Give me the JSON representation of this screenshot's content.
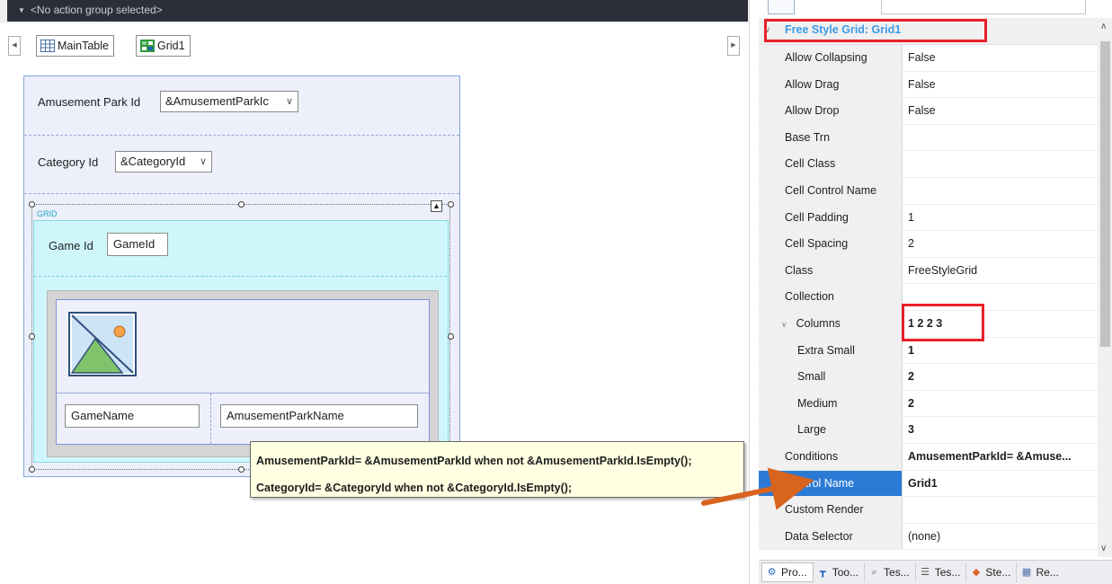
{
  "designer": {
    "action_group": "<No action group selected>",
    "tabs": [
      "MainTable",
      "Grid1"
    ],
    "form": {
      "amusement_park_label": "Amusement Park Id",
      "amusement_park_value": "&AmusementParkIc",
      "category_label": "Category Id",
      "category_value": "&CategoryId",
      "grid_caption": "GRID",
      "game_id_label": "Game Id",
      "game_id_value": "GameId",
      "game_name_value": "GameName",
      "park_name_value": "AmusementParkName"
    }
  },
  "tooltip": {
    "line1": "AmusementParkId= &AmusementParkId when not &AmusementParkId.IsEmpty();",
    "line2": "CategoryId= &CategoryId when not &CategoryId.IsEmpty();"
  },
  "properties": {
    "title": "Free Style Grid: Grid1",
    "rows": [
      {
        "name": "Allow Collapsing",
        "value": "False"
      },
      {
        "name": "Allow Drag",
        "value": "False"
      },
      {
        "name": "Allow Drop",
        "value": "False"
      },
      {
        "name": "Base Trn",
        "value": ""
      },
      {
        "name": "Cell Class",
        "value": ""
      },
      {
        "name": "Cell Control Name",
        "value": ""
      },
      {
        "name": "Cell Padding",
        "value": "1"
      },
      {
        "name": "Cell Spacing",
        "value": "2"
      },
      {
        "name": "Class",
        "value": "FreeStyleGrid"
      },
      {
        "name": "Collection",
        "value": ""
      },
      {
        "name": "Columns",
        "value": "1 2 2 3"
      },
      {
        "name": "Extra Small",
        "value": "1"
      },
      {
        "name": "Small",
        "value": "2"
      },
      {
        "name": "Medium",
        "value": "2"
      },
      {
        "name": "Large",
        "value": "3"
      },
      {
        "name": "Conditions",
        "value": "AmusementParkId= &Amuse..."
      },
      {
        "name": "Control Name",
        "value": "Grid1"
      },
      {
        "name": "Custom Render",
        "value": ""
      },
      {
        "name": "Data Selector",
        "value": "(none)"
      }
    ],
    "bottom_tabs": [
      "Pro...",
      "Too...",
      "Tes...",
      "Tes...",
      "Ste...",
      "Re..."
    ]
  },
  "colors": {
    "accent_title": "#3c9be8",
    "highlight_red": "#e8202a",
    "arrow_orange": "#d9641e",
    "selection_blue": "#2b7bd6"
  }
}
